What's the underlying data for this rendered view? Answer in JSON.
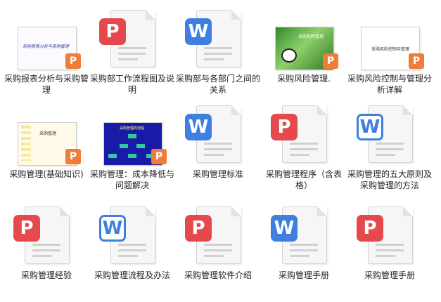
{
  "files": [
    {
      "label": "采购报表分析与采购管理",
      "type": "ppt",
      "thumb_text": "采购报表分析与采购管理"
    },
    {
      "label": "采购部工作流程图及说明",
      "type": "pdf"
    },
    {
      "label": "采购部与各部门之间的关系",
      "type": "word"
    },
    {
      "label": "采购风险管理.",
      "type": "ppt",
      "thumb_text": "采购风险管理"
    },
    {
      "label": "采购风险控制与管理分析详解",
      "type": "ppt",
      "thumb_text": "采购风险控制与管理"
    },
    {
      "label": "采购管理(基础知识)",
      "type": "ppt",
      "thumb_text": "采购管理"
    },
    {
      "label": "采购管理：成本降低与问题解决",
      "type": "ppt",
      "thumb_text": "采购管理的流程"
    },
    {
      "label": "采购管理标准",
      "type": "word"
    },
    {
      "label": "采购管理程序（含表格）",
      "type": "pdf"
    },
    {
      "label": "采购管理的五大原则及采购管理的方法",
      "type": "word-outline"
    },
    {
      "label": "采购管理经验",
      "type": "pdf"
    },
    {
      "label": "采购管理流程及办法",
      "type": "word-outline"
    },
    {
      "label": "采购管理软件介绍",
      "type": "pdf"
    },
    {
      "label": "采购管理手册",
      "type": "word"
    },
    {
      "label": "采购管理手册",
      "type": "pdf"
    }
  ],
  "icons": {
    "pdf_glyph": "P",
    "word_glyph": "W",
    "ppt_glyph": "P"
  }
}
